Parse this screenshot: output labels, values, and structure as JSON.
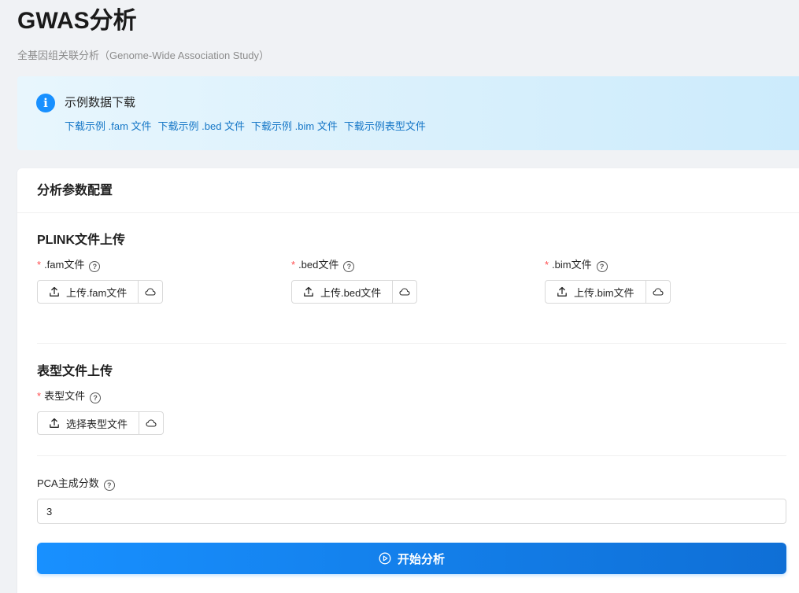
{
  "page": {
    "title": "GWAS分析",
    "subtitle": "全基因组关联分析（Genome-Wide Association Study）"
  },
  "banner": {
    "title": "示例数据下载",
    "links": [
      "下载示例 .fam 文件",
      "下载示例 .bed 文件",
      "下载示例 .bim 文件",
      "下载示例表型文件"
    ]
  },
  "card": {
    "title": "分析参数配置"
  },
  "plink": {
    "section_title": "PLINK文件上传",
    "fields": [
      {
        "label": ".fam文件",
        "required": "*",
        "button": "上传.fam文件"
      },
      {
        "label": ".bed文件",
        "required": "*",
        "button": "上传.bed文件"
      },
      {
        "label": ".bim文件",
        "required": "*",
        "button": "上传.bim文件"
      }
    ]
  },
  "phenotype": {
    "section_title": "表型文件上传",
    "label": "表型文件",
    "required": "*",
    "button": "选择表型文件"
  },
  "pca": {
    "label": "PCA主成分数",
    "value": "3"
  },
  "actions": {
    "start_label": "开始分析"
  },
  "icons": {
    "help": "?",
    "info": "i"
  },
  "colors": {
    "primary": "#1890ff",
    "link": "#1677c7",
    "required": "#ff4d4f"
  }
}
